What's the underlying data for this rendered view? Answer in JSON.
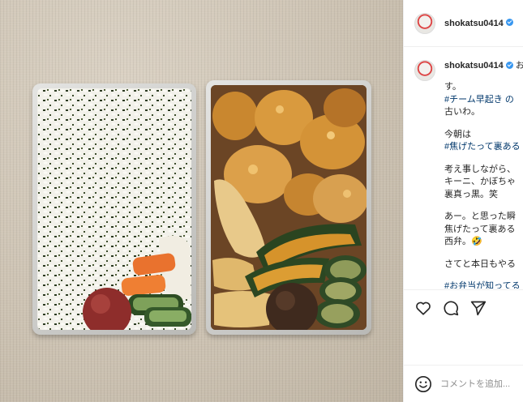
{
  "post": {
    "username": "shokatsu0414",
    "verified": true,
    "photo_alt": "Two aluminum bento boxes: seasoned rice with umeboshi, pickles; fried chicken, chikuwa, kabocha and shiitake"
  },
  "caption": {
    "username": "shokatsu0414",
    "first_line_rest": "お",
    "lines": [
      {
        "text": "す。",
        "type": "text"
      },
      {
        "text": "#チーム早起き の",
        "type": "tag"
      },
      {
        "text": "古いわ。",
        "type": "text"
      },
      {
        "text": "",
        "type": "gap"
      },
      {
        "text": "今朝は",
        "type": "text"
      },
      {
        "text": "#焦げたって裏ある",
        "type": "tag"
      },
      {
        "text": "",
        "type": "gap"
      },
      {
        "text": "考え事しながら、",
        "type": "text"
      },
      {
        "text": "キーニ、かぼちゃ",
        "type": "text"
      },
      {
        "text": "裏真っ黒。笑",
        "type": "text"
      },
      {
        "text": "",
        "type": "gap"
      },
      {
        "text": "あー。と思った瞬",
        "type": "text"
      },
      {
        "text": "焦げたって裏ある",
        "type": "text"
      },
      {
        "text": "西弁。🤣",
        "type": "text"
      },
      {
        "text": "",
        "type": "gap"
      },
      {
        "text": "さてと本日もやる",
        "type": "text"
      },
      {
        "text": "",
        "type": "gap"
      },
      {
        "text": "#お弁当が知ってる",
        "type": "tag"
      }
    ]
  },
  "actions": {
    "like_icon": "heart-icon",
    "comment_icon": "comment-icon",
    "share_icon": "share-icon"
  },
  "comment": {
    "placeholder": "コメントを追加...",
    "emoji_icon": "emoji-icon"
  }
}
